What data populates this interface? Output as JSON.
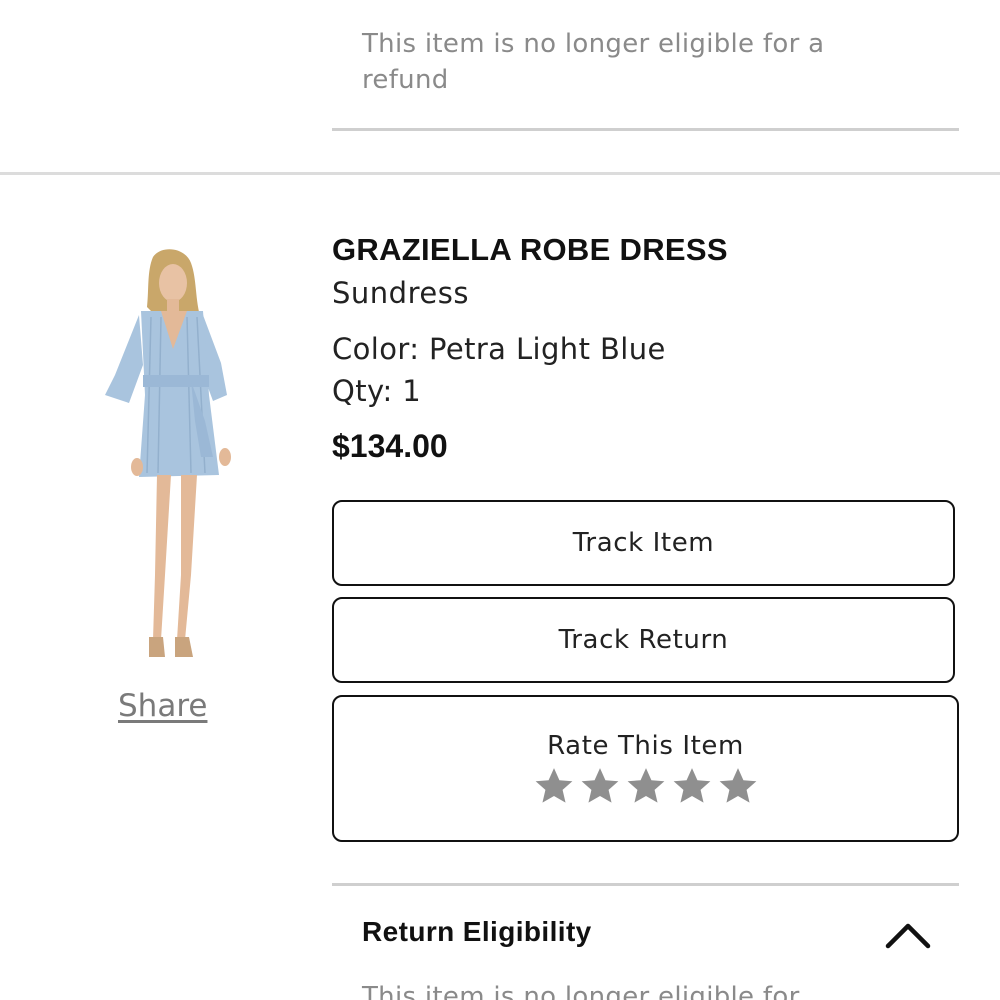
{
  "previous_item": {
    "refund_note": "This item is no longer eligible for a refund"
  },
  "item": {
    "name": "GRAZIELLA ROBE DRESS",
    "type": "Sundress",
    "color_line": "Color: Petra Light Blue",
    "qty_line": "Qty: 1",
    "price": "$134.00",
    "share_label": "Share",
    "image_icon": "product-photo-dress",
    "dress_color": "#a9c4de"
  },
  "actions": {
    "track_item": "Track Item",
    "track_return": "Track Return",
    "rate_label": "Rate This Item",
    "rating": {
      "filled": 0,
      "max": 5,
      "star_color": "#8f8f8f"
    }
  },
  "return_section": {
    "title": "Return Eligibility",
    "expanded": true,
    "toggle_icon": "chevron-up-icon",
    "note": "This item is no longer eligible for"
  }
}
